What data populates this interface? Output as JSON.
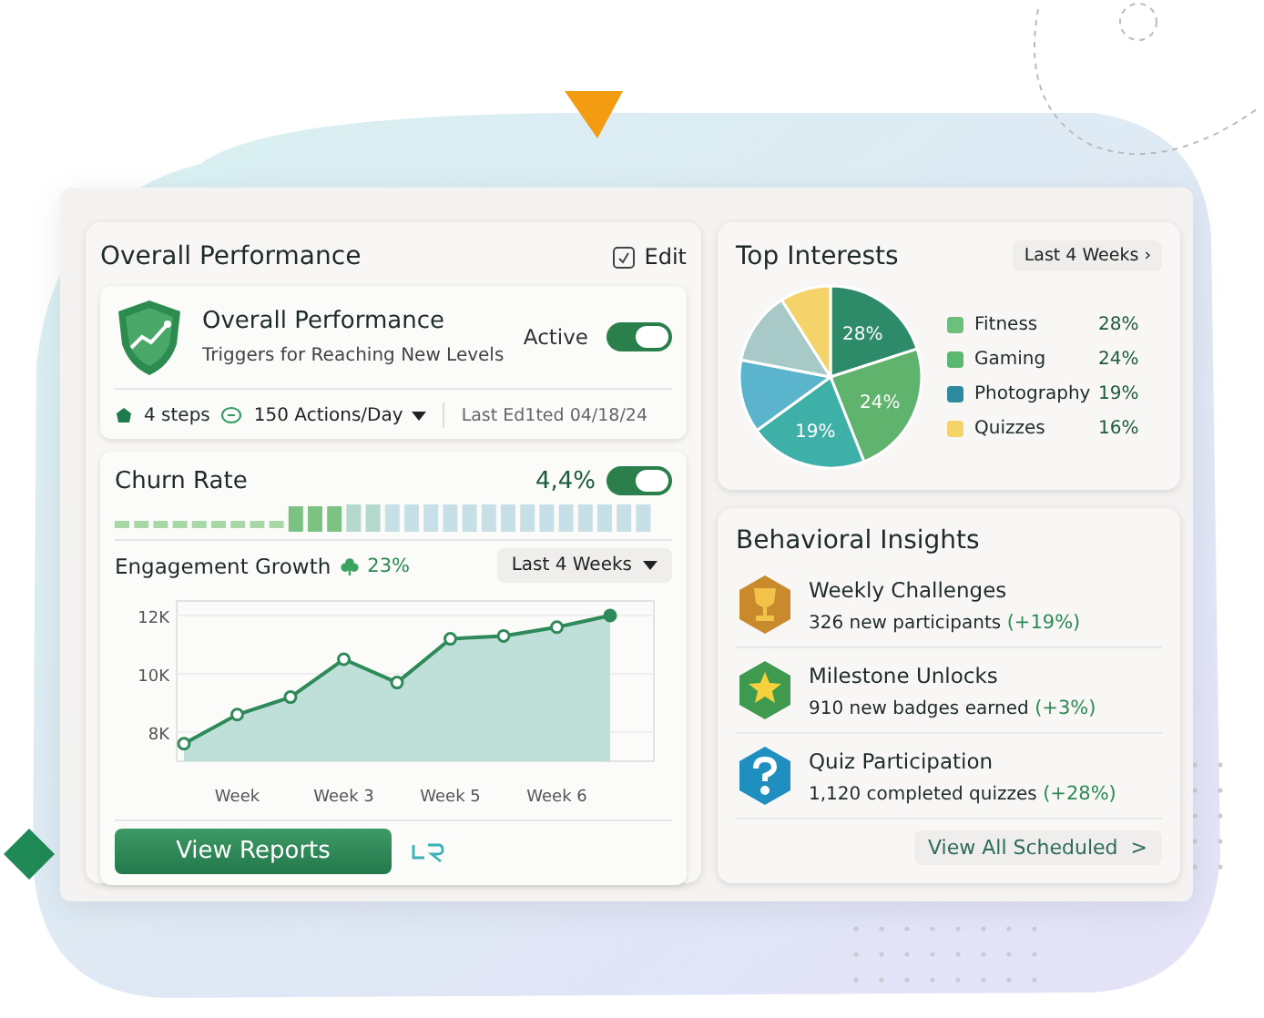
{
  "performance": {
    "title": "Overall Performance",
    "edit": "Edit",
    "rule": {
      "title": "Overall Performance",
      "subtitle": "Triggers for Reaching New Levels",
      "status": "Active",
      "on": true,
      "steps": "4 steps",
      "rate": "150 Actions/Day",
      "edited": "Last Ed1ted 04/18/24"
    },
    "churn": {
      "title": "Churn Rate",
      "value": "4,4%",
      "on": true
    },
    "engagement": {
      "title": "Engagement Growth",
      "change": "23%",
      "range": "Last 4 Weeks",
      "chart_data": {
        "type": "area",
        "grid": true,
        "categories": [
          null,
          "Week",
          null,
          "Week 3",
          null,
          "Week 5",
          null,
          "Week 6",
          null
        ],
        "series": [
          {
            "color": "#2f8a5a",
            "marker": "o",
            "values": [
              7.6,
              8.6,
              9.2,
              10.5,
              9.7,
              11.2,
              11.3,
              11.6,
              12.0
            ]
          }
        ],
        "ylim": [
          7,
          12.5
        ],
        "yticks": [
          {
            "value": 8,
            "label": "8K"
          },
          {
            "value": 10,
            "label": "10K"
          },
          {
            "value": 12,
            "label": "12K"
          }
        ]
      }
    },
    "button": "View Reports"
  },
  "interests": {
    "title": "Top Interests",
    "range": "Last 4 Weeks ›",
    "pie": {
      "kind": "picture",
      "labels": [
        "28%",
        "24%",
        "19%"
      ]
    },
    "legend": [
      {
        "name": "Fitness",
        "value": "28%",
        "color": "#6cbf7c"
      },
      {
        "name": "Gaming",
        "value": "24%",
        "color": "#5cb870"
      },
      {
        "name": "Photography",
        "value": "19%",
        "color": "#2f8aa0"
      },
      {
        "name": "Quizzes",
        "value": "16%",
        "color": "#f4d46a"
      }
    ]
  },
  "insights": {
    "title": "Behavioral Insights",
    "link": "View All Scheduled  >",
    "items": [
      {
        "kind": "trophy",
        "title": "Weekly Challenges",
        "text": "326 new participants",
        "change": "(+19%)"
      },
      {
        "kind": "star",
        "title": "Milestone Unlocks",
        "text": "910 new badges earned",
        "change": "(+3%)"
      },
      {
        "kind": "question",
        "title": "Quiz Participation",
        "text": "1,120 completed quizzes",
        "change": "(+28%)"
      }
    ]
  }
}
